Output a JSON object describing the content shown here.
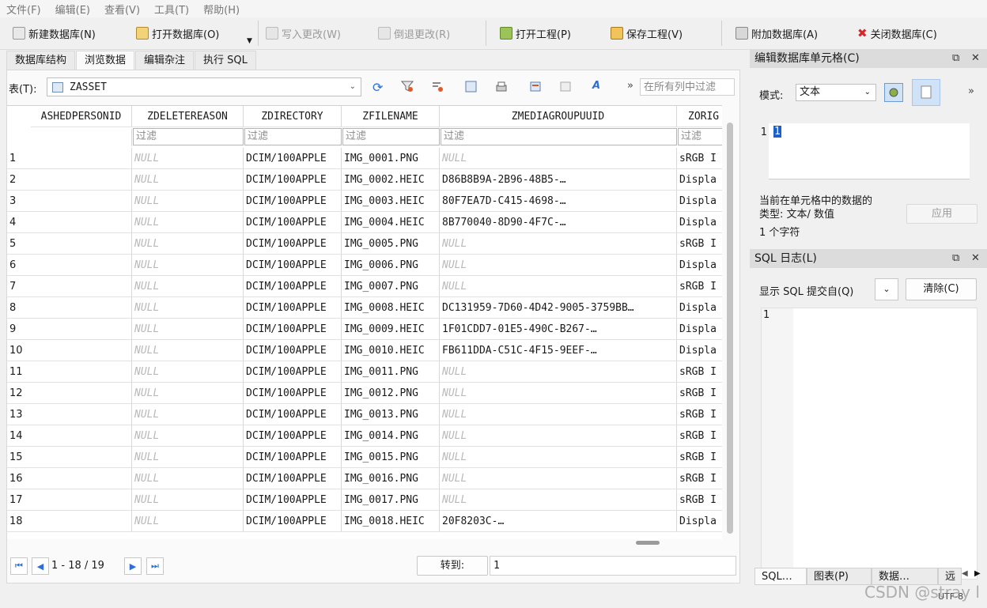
{
  "menu": [
    "文件(F)",
    "编辑(E)",
    "查看(V)",
    "工具(T)",
    "帮助(H)"
  ],
  "toolbar": {
    "new_db": "新建数据库(N)",
    "open_db": "打开数据库(O)",
    "write_changes": "写入更改(W)",
    "revert_changes": "倒退更改(R)",
    "open_project": "打开工程(P)",
    "save_project": "保存工程(V)",
    "attach_db": "附加数据库(A)",
    "close_db": "关闭数据库(C)"
  },
  "tabs": [
    "数据库结构",
    "浏览数据",
    "编辑杂注",
    "执行 SQL"
  ],
  "browse": {
    "table_label": "表(T):",
    "table_value": "ZASSET",
    "filter_all_placeholder": "在所有列中过滤",
    "filter_placeholder": "过滤",
    "columns": [
      "ASHEDPERSONID",
      "ZDELETEREASON",
      "ZDIRECTORY",
      "ZFILENAME",
      "ZMEDIAGROUPUUID",
      "ZORIG"
    ],
    "rows": [
      {
        "n": "1",
        "dir": "DCIM/100APPLE",
        "file": "IMG_0001.PNG",
        "uuid": "NULL",
        "orig": "sRGB I"
      },
      {
        "n": "2",
        "dir": "DCIM/100APPLE",
        "file": "IMG_0002.HEIC",
        "uuid": "D86B8B9A-2B96-48B5-…",
        "orig": "Displa"
      },
      {
        "n": "3",
        "dir": "DCIM/100APPLE",
        "file": "IMG_0003.HEIC",
        "uuid": "80F7EA7D-C415-4698-…",
        "orig": "Displa"
      },
      {
        "n": "4",
        "dir": "DCIM/100APPLE",
        "file": "IMG_0004.HEIC",
        "uuid": "8B770040-8D90-4F7C-…",
        "orig": "Displa"
      },
      {
        "n": "5",
        "dir": "DCIM/100APPLE",
        "file": "IMG_0005.PNG",
        "uuid": "NULL",
        "orig": "sRGB I"
      },
      {
        "n": "6",
        "dir": "DCIM/100APPLE",
        "file": "IMG_0006.PNG",
        "uuid": "NULL",
        "orig": "Displa"
      },
      {
        "n": "7",
        "dir": "DCIM/100APPLE",
        "file": "IMG_0007.PNG",
        "uuid": "NULL",
        "orig": "sRGB I"
      },
      {
        "n": "8",
        "dir": "DCIM/100APPLE",
        "file": "IMG_0008.HEIC",
        "uuid": "DC131959-7D60-4D42-9005-3759BB…",
        "orig": "Displa"
      },
      {
        "n": "9",
        "dir": "DCIM/100APPLE",
        "file": "IMG_0009.HEIC",
        "uuid": "1F01CDD7-01E5-490C-B267-…",
        "orig": "Displa"
      },
      {
        "n": "10",
        "dir": "DCIM/100APPLE",
        "file": "IMG_0010.HEIC",
        "uuid": "FB611DDA-C51C-4F15-9EEF-…",
        "orig": "Displa"
      },
      {
        "n": "11",
        "dir": "DCIM/100APPLE",
        "file": "IMG_0011.PNG",
        "uuid": "NULL",
        "orig": "sRGB I"
      },
      {
        "n": "12",
        "dir": "DCIM/100APPLE",
        "file": "IMG_0012.PNG",
        "uuid": "NULL",
        "orig": "sRGB I"
      },
      {
        "n": "13",
        "dir": "DCIM/100APPLE",
        "file": "IMG_0013.PNG",
        "uuid": "NULL",
        "orig": "sRGB I"
      },
      {
        "n": "14",
        "dir": "DCIM/100APPLE",
        "file": "IMG_0014.PNG",
        "uuid": "NULL",
        "orig": "sRGB I"
      },
      {
        "n": "15",
        "dir": "DCIM/100APPLE",
        "file": "IMG_0015.PNG",
        "uuid": "NULL",
        "orig": "sRGB I"
      },
      {
        "n": "16",
        "dir": "DCIM/100APPLE",
        "file": "IMG_0016.PNG",
        "uuid": "NULL",
        "orig": "sRGB I"
      },
      {
        "n": "17",
        "dir": "DCIM/100APPLE",
        "file": "IMG_0017.PNG",
        "uuid": "NULL",
        "orig": "sRGB I"
      },
      {
        "n": "18",
        "dir": "DCIM/100APPLE",
        "file": "IMG_0018.HEIC",
        "uuid": "20F8203C-…",
        "orig": "Displa"
      }
    ],
    "null_text": "NULL",
    "pager": "1 - 18 / 19",
    "goto_label": "转到:",
    "goto_value": "1"
  },
  "edit_cell": {
    "title": "编辑数据库单元格(C)",
    "mode_label": "模式:",
    "mode_value": "文本",
    "line_no": "1",
    "cell_value": "1",
    "type_info_1": "当前在单元格中的数据的",
    "type_info_2": "类型: 文本/ 数值",
    "char_count": "1 个字符",
    "apply": "应用"
  },
  "sql_log": {
    "title": "SQL 日志(L)",
    "show_label": "显示 SQL 提交自(Q)",
    "clear": "清除(C)",
    "line_no": "1"
  },
  "bottom_tabs": [
    "SQL…",
    "图表(P)",
    "数据…",
    "远"
  ],
  "status": {
    "encoding": "UTF-8"
  },
  "watermark": "CSDN @stray l",
  "colors": {
    "accent": "#2d6fd6",
    "selection": "#1e5fc7",
    "null_text": "#b9b9b9"
  }
}
